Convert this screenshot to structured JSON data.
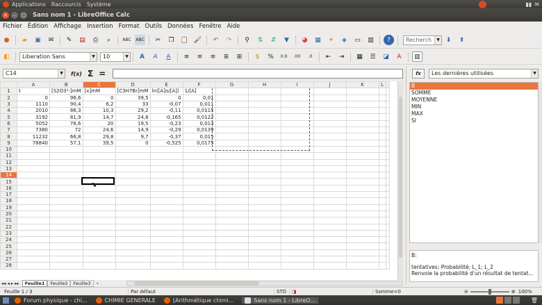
{
  "panel": {
    "applications": "Applications",
    "places": "Raccourcis",
    "system": "Système"
  },
  "window": {
    "title": "Sans nom 1 - LibreOffice Calc"
  },
  "menu": [
    "Fichier",
    "Édition",
    "Affichage",
    "Insertion",
    "Format",
    "Outils",
    "Données",
    "Fenêtre",
    "Aide"
  ],
  "toolbar": {
    "search_placeholder": "Recherch",
    "font_name": "Liberation Sans",
    "font_size": "10"
  },
  "formula": {
    "cell_ref": "C14",
    "fx": "f(x)",
    "sum": "Σ",
    "equals": "=",
    "content": ""
  },
  "sheet": {
    "columns": [
      "A",
      "B",
      "C",
      "D",
      "E",
      "F",
      "G",
      "H",
      "I",
      "J",
      "K",
      "L"
    ],
    "selected_column": "C",
    "selected_row": 14,
    "rows": [
      [
        "t",
        "[S2O3²-]mM",
        "[x]mM",
        "[C3H7Br]mM",
        "ln([A]o/[A])",
        "1/[A]",
        "",
        "",
        "",
        "",
        "",
        ""
      ],
      [
        "0",
        "96,6",
        "0",
        "39,5",
        "0",
        "0,01",
        "",
        "",
        "",
        "",
        "",
        ""
      ],
      [
        "1110",
        "90,4",
        "6,2",
        "33",
        "-0,07",
        "0,011",
        "",
        "",
        "",
        "",
        "",
        ""
      ],
      [
        "2010",
        "86,3",
        "10,3",
        "29,2",
        "-0,11",
        "0,0115",
        "",
        "",
        "",
        "",
        "",
        ""
      ],
      [
        "3192",
        "81,9",
        "14,7",
        "24,8",
        "-0,165",
        "0,0122",
        "",
        "",
        "",
        "",
        "",
        ""
      ],
      [
        "5052",
        "76,6",
        "20",
        "19,5",
        "-0,23",
        "0,013",
        "",
        "",
        "",
        "",
        "",
        ""
      ],
      [
        "7380",
        "72",
        "24,6",
        "14,9",
        "-0,29",
        "0,0139",
        "",
        "",
        "",
        "",
        "",
        ""
      ],
      [
        "11232",
        "66,8",
        "29,8",
        "9,7",
        "-0,37",
        "0,015",
        "",
        "",
        "",
        "",
        "",
        ""
      ],
      [
        "78840",
        "57,1",
        "39,5",
        "0",
        "-0,525",
        "0,0175",
        "",
        "",
        "",
        "",
        "",
        ""
      ]
    ],
    "total_rows": 28,
    "tabs": [
      "Feuille1",
      "Feuille2",
      "Feuille3"
    ]
  },
  "sidebar": {
    "header": "Les dernières utilisées",
    "functions": [
      "B",
      "SOMME",
      "MOYENNE",
      "MIN",
      "MAX",
      "SI"
    ],
    "selected_function": "B",
    "detail_name": "B:",
    "detail_syntax": "tentatives; Probabilité; L_1; L_2",
    "detail_desc": "Renvoie la probabilité d'un résultat de tentat..."
  },
  "status": {
    "sheet": "Feuille 1 / 3",
    "style": "Par défaut",
    "mode": "STD",
    "sum": "Somme=0",
    "zoom": "100%"
  },
  "taskbar": [
    "Forum physique - chi...",
    "CHIMIE GENERALE",
    "[Arithmétique chimi...",
    "Sans nom 1 - LibreO..."
  ],
  "colors": {
    "accent": "#e9753c",
    "panel": "#3c3b37"
  }
}
